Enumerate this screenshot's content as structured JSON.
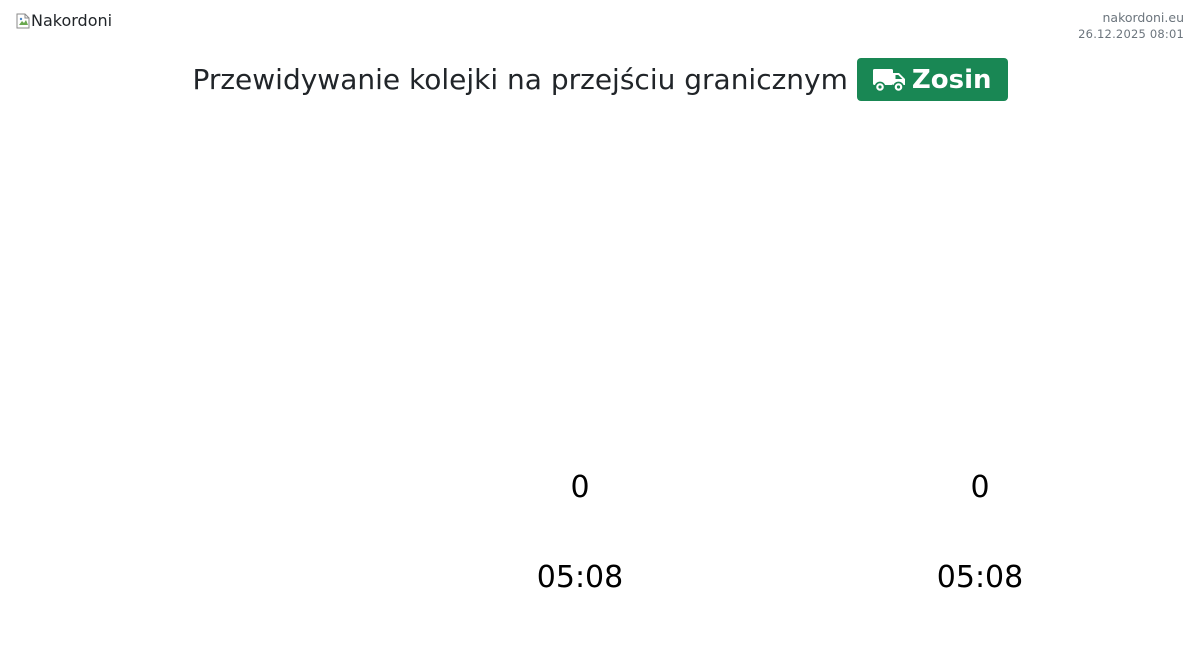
{
  "header": {
    "logo_alt": "Nakordoni",
    "site": "nakordoni.eu",
    "datetime": "26.12.2025 08:01"
  },
  "title": {
    "text": "Przewidywanie kolejki na przejściu granicznym",
    "badge_label": "Zosin",
    "badge_icon": "truck-icon",
    "badge_color": "#198754"
  },
  "columns": [
    {
      "count": "0",
      "time": "05:08"
    },
    {
      "count": "0",
      "time": "05:08"
    }
  ]
}
